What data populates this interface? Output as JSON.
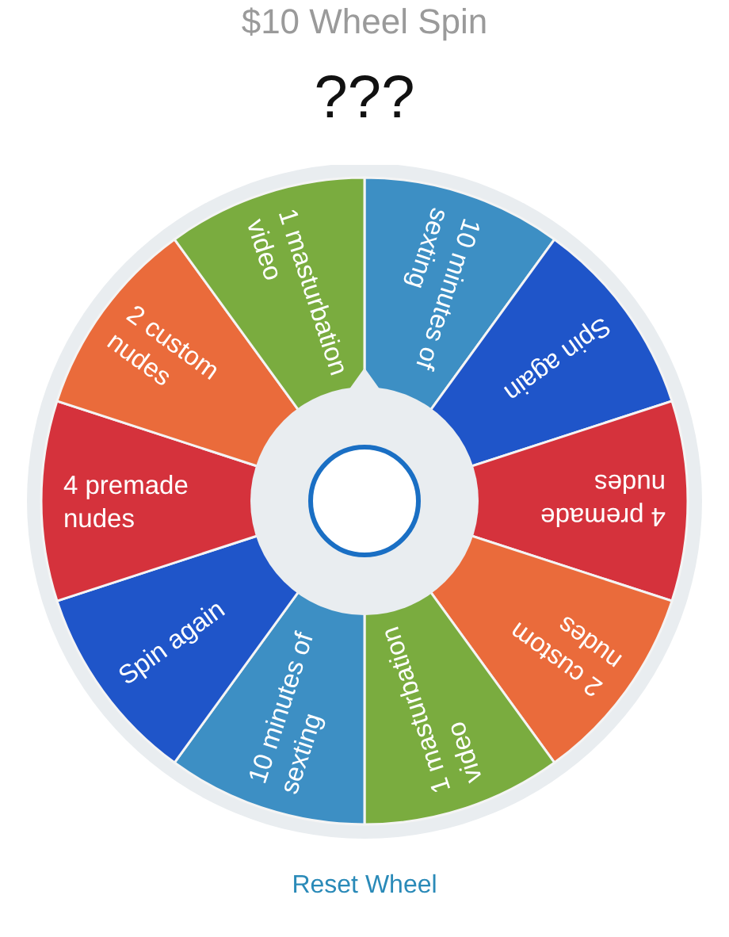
{
  "title": "$10 Wheel Spin",
  "result": "???",
  "segments": [
    {
      "lines": [
        "10 minutes of",
        "sexting"
      ],
      "color": "#3d8fc4"
    },
    {
      "lines": [
        "Spin again"
      ],
      "color": "#1f55c9"
    },
    {
      "lines": [
        "4 premade",
        "nudes"
      ],
      "color": "#d5323c"
    },
    {
      "lines": [
        "2 custom",
        "nudes"
      ],
      "color": "#ea6b3b"
    },
    {
      "lines": [
        "1 masturbation",
        "video"
      ],
      "color": "#7aac3f"
    },
    {
      "lines": [
        "10 minutes of",
        "sexting"
      ],
      "color": "#3d8fc4"
    },
    {
      "lines": [
        "Spin again"
      ],
      "color": "#1f55c9"
    },
    {
      "lines": [
        "4 premade",
        "nudes"
      ],
      "color": "#d5323c"
    },
    {
      "lines": [
        "2 custom",
        "nudes"
      ],
      "color": "#ea6b3b"
    },
    {
      "lines": [
        "1 masturbation",
        "video"
      ],
      "color": "#7aac3f"
    }
  ],
  "reset_button": "Reset Wheel"
}
